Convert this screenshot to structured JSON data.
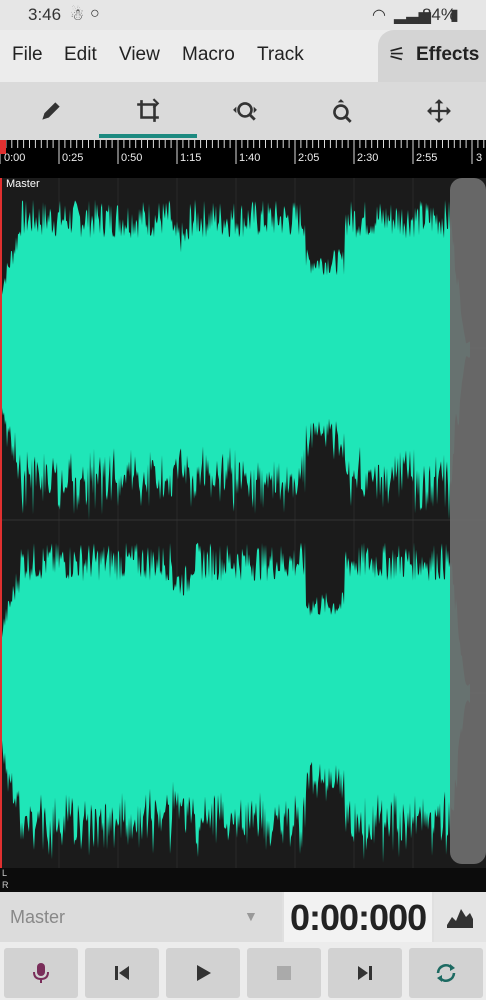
{
  "status": {
    "time": "3:46",
    "battery": "84%"
  },
  "menu": {
    "items": [
      "File",
      "Edit",
      "View",
      "Macro",
      "Track"
    ],
    "effects": "Effects"
  },
  "toolbar": {
    "tools": [
      "pencil-tool",
      "crop-tool",
      "zoom-horizontal-tool",
      "zoom-vertical-tool",
      "move-tool"
    ],
    "active": "crop-tool"
  },
  "timeline": {
    "ticks": [
      "0:00",
      "0:25",
      "0:50",
      "1:15",
      "1:40",
      "2:05",
      "2:30",
      "2:55",
      "3"
    ]
  },
  "track": {
    "label": "Master",
    "left_channel": "L",
    "right_channel": "R"
  },
  "transport": {
    "track_name": "Master",
    "time": "0:00:000"
  },
  "colors": {
    "waveform": "#1fe6b8",
    "accent": "#1d8a80",
    "playhead": "#e03030"
  }
}
